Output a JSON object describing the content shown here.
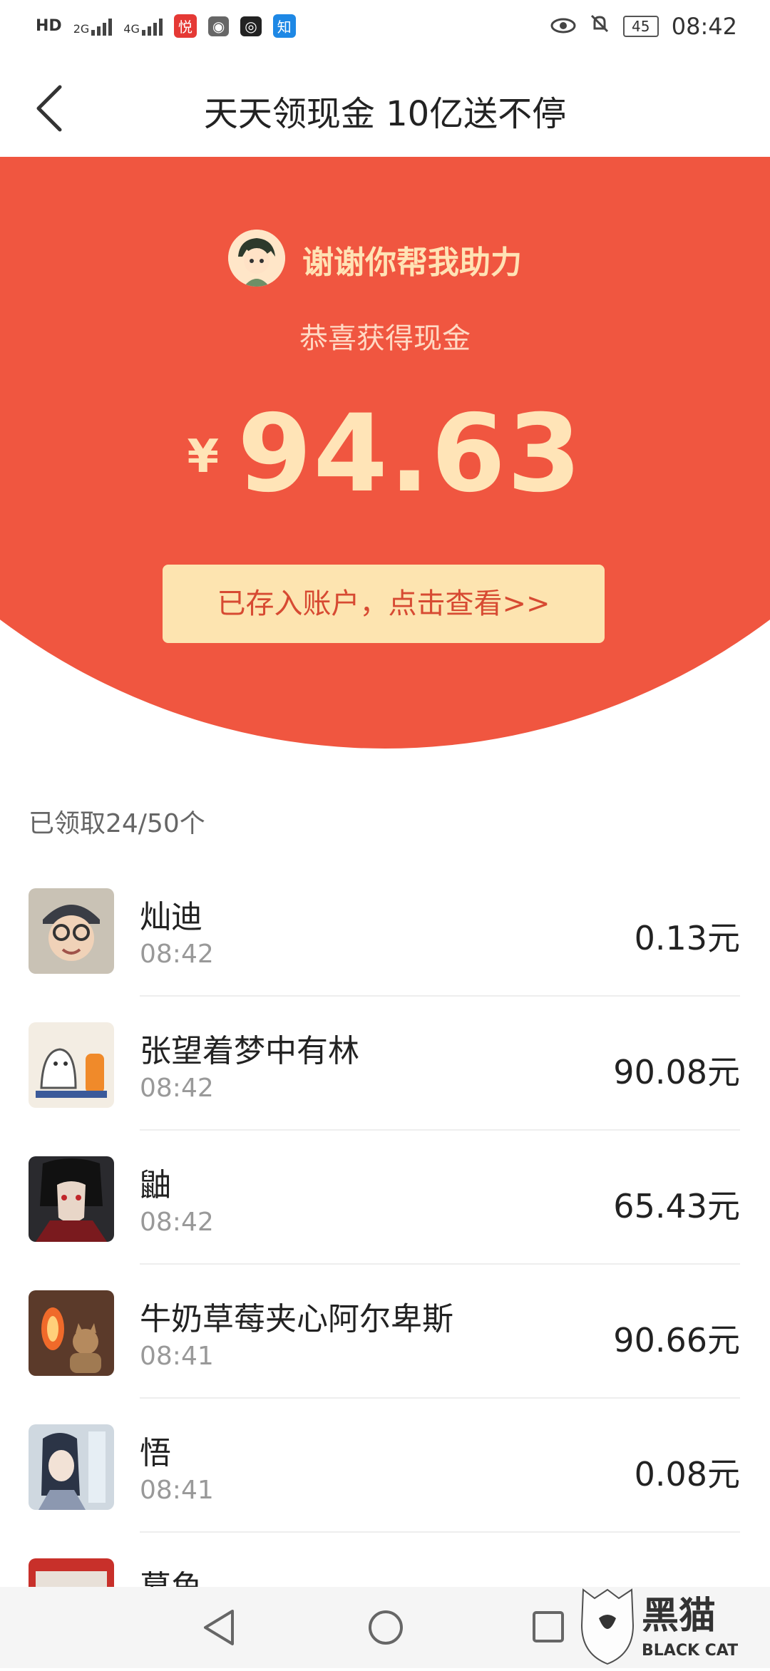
{
  "status_bar": {
    "left_badges": [
      "HD",
      "2G",
      "4G"
    ],
    "app_badges": [
      "悦",
      "知"
    ],
    "time": "08:42",
    "battery": "45"
  },
  "header": {
    "title": "天天领现金 10亿送不停"
  },
  "hero": {
    "thanks_text": "谢谢你帮我助力",
    "congrats_text": "恭喜获得现金",
    "currency": "¥",
    "amount": "94.63",
    "account_button": "已存入账户，点击查看>>"
  },
  "list": {
    "count_label": "已领取24/50个",
    "items": [
      {
        "name": "灿迪",
        "time": "08:42",
        "amount": "0.13元"
      },
      {
        "name": "张望着梦中有林",
        "time": "08:42",
        "amount": "90.08元"
      },
      {
        "name": "鼬",
        "time": "08:42",
        "amount": "65.43元"
      },
      {
        "name": "牛奶草莓夹心阿尔卑斯",
        "time": "08:41",
        "amount": "90.66元"
      },
      {
        "name": "悟",
        "time": "08:41",
        "amount": "0.08元"
      },
      {
        "name": "墓鱼",
        "time": "",
        "amount": ""
      }
    ]
  },
  "watermark": {
    "text": "黑猫",
    "subtext": "BLACK CAT"
  },
  "colors": {
    "hero_red": "#f05640",
    "gold": "#ffe4b7",
    "button_bg": "#fde4b0",
    "button_text": "#d74a32"
  }
}
